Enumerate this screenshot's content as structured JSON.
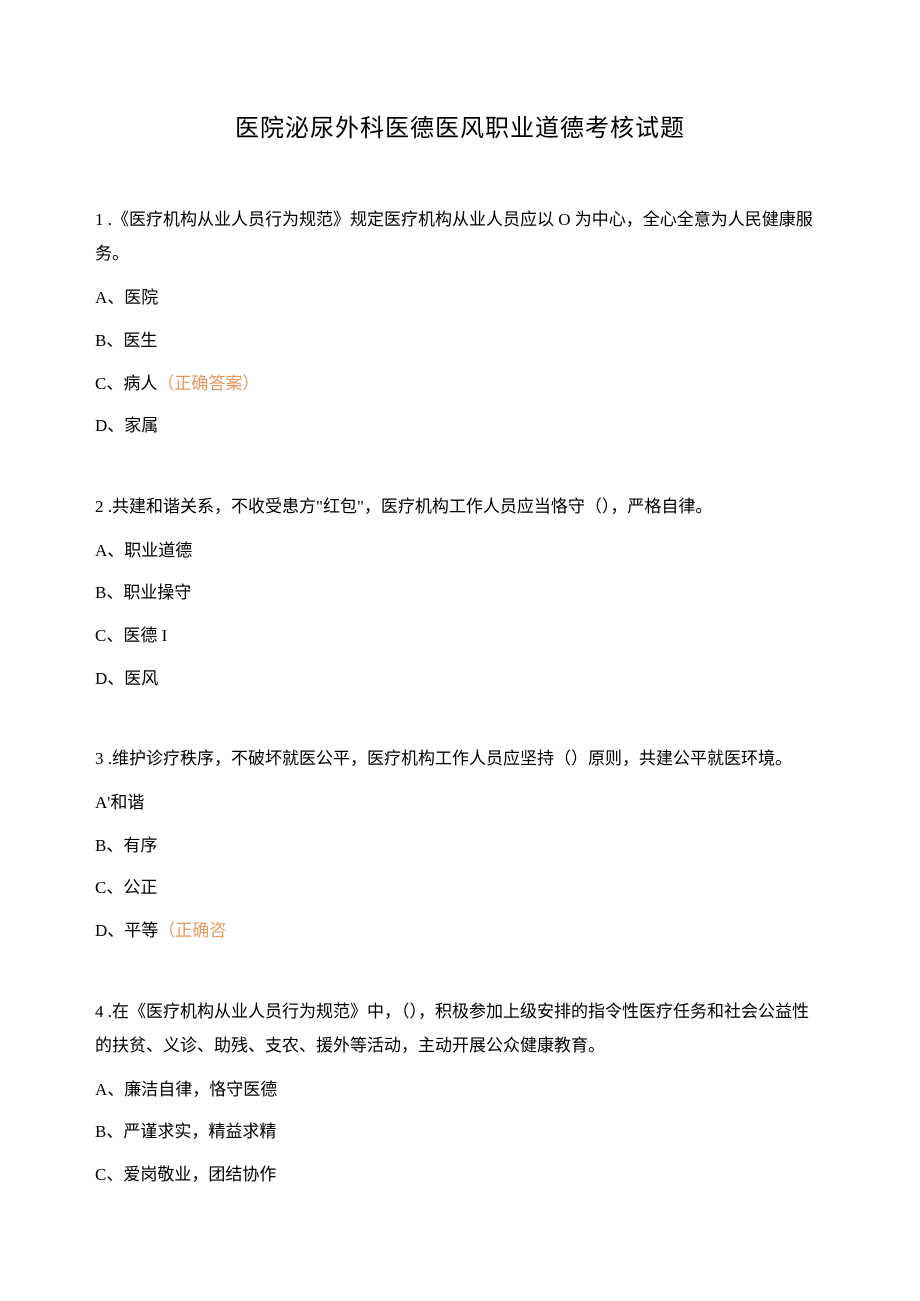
{
  "title": "医院泌尿外科医德医风职业道德考核试题",
  "questions": [
    {
      "num": "1",
      "text": " .《医疗机构从业人员行为规范》规定医疗机构从业人员应以 O 为中心，全心全意为人民健康服务。",
      "options": [
        {
          "label": "A、医院",
          "correct": ""
        },
        {
          "label": "B、医生",
          "correct": ""
        },
        {
          "label": "C、病人",
          "correct": "（正确答案）"
        },
        {
          "label": "D、家属",
          "correct": ""
        }
      ]
    },
    {
      "num": "2",
      "text": " .共建和谐关系，不收受患方\"红包\"，医疗机构工作人员应当恪守（），严格自律。",
      "options": [
        {
          "label": "A、职业道德",
          "correct": ""
        },
        {
          "label": "B、职业操守",
          "correct": ""
        },
        {
          "label": "C、医德 I",
          "correct": ""
        },
        {
          "label": "D、医风",
          "correct": ""
        }
      ]
    },
    {
      "num": "3",
      "text": " .维护诊疗秩序，不破坏就医公平，医疗机构工作人员应坚持（）原则，共建公平就医环境。",
      "options": [
        {
          "label": "A'和谐",
          "correct": ""
        },
        {
          "label": "B、有序",
          "correct": ""
        },
        {
          "label": "C、公正",
          "correct": ""
        },
        {
          "label": "D、平等",
          "correct": "（正确咨"
        }
      ]
    },
    {
      "num": "4",
      "text": " .在《医疗机构从业人员行为规范》中，（），积极参加上级安排的指令性医疗任务和社会公益性的扶贫、义诊、助残、支农、援外等活动，主动开展公众健康教育。",
      "options": [
        {
          "label": "A、廉洁自律，恪守医德",
          "correct": ""
        },
        {
          "label": "B、严谨求实，精益求精",
          "correct": ""
        },
        {
          "label": "C、爱岗敬业，团结协作",
          "correct": ""
        }
      ]
    }
  ]
}
